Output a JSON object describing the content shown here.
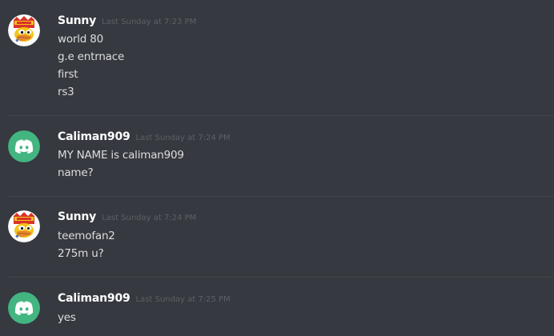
{
  "colors": {
    "background": "#36393f",
    "username": "#ffffff",
    "timestamp": "#5d6066",
    "message_text": "#dcddde",
    "divider": "#42454a",
    "discord_green": "#43b581"
  },
  "messages": [
    {
      "author": "Sunny",
      "avatar_icon": "duck-avatar-icon",
      "timestamp": "Last Sunday at 7:23 PM",
      "lines": [
        "world 80",
        "g.e entrnace",
        "first",
        "rs3"
      ]
    },
    {
      "author": "Caliman909",
      "avatar_icon": "discord-default-avatar-icon",
      "timestamp": "Last Sunday at 7:24 PM",
      "lines": [
        "MY NAME is caliman909",
        "name?"
      ]
    },
    {
      "author": "Sunny",
      "avatar_icon": "duck-avatar-icon",
      "timestamp": "Last Sunday at 7:24 PM",
      "lines": [
        "teemofan2",
        "275m u?"
      ]
    },
    {
      "author": "Caliman909",
      "avatar_icon": "discord-default-avatar-icon",
      "timestamp": "Last Sunday at 7:25 PM",
      "lines": [
        "yes"
      ]
    }
  ]
}
